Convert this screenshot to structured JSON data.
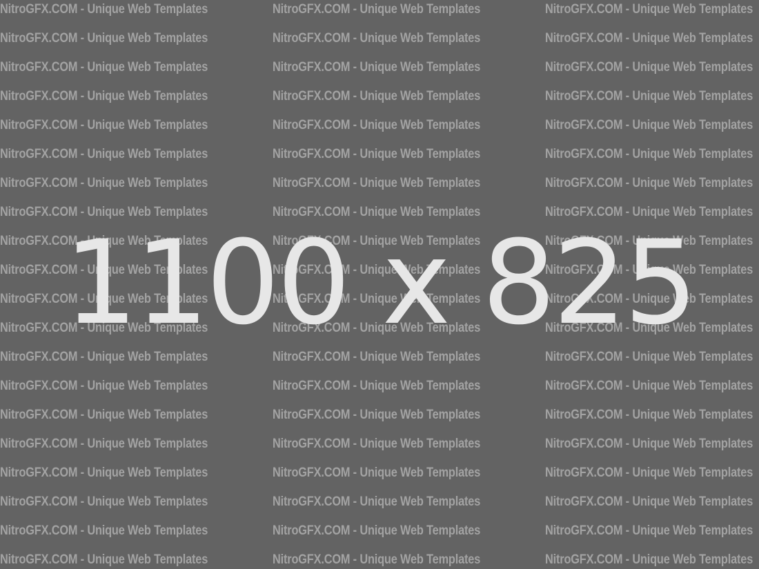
{
  "placeholder": {
    "dimensions_text": "1100 x 825",
    "watermark_text": "NitroGFX.COM - Unique Web Templates",
    "background_color": "#636363",
    "watermark_color": "#a3a3a3",
    "dimensions_color": "#e7e7e7"
  }
}
